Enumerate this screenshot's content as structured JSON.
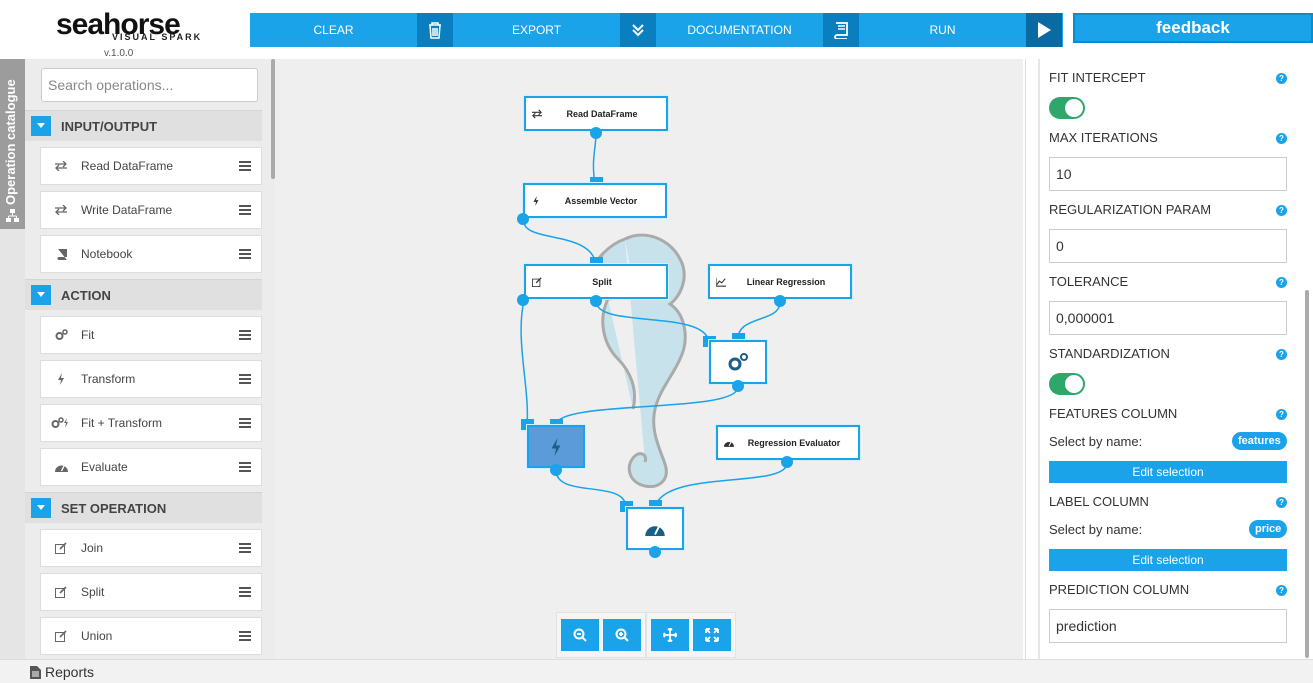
{
  "app": {
    "brand_main": "seahorse",
    "brand_sub": "VISUAL SPARK",
    "version": "v.1.0.0"
  },
  "toolbar": {
    "clear_label": "CLEAR",
    "export_label": "EXPORT",
    "documentation_label": "DOCUMENTATION",
    "run_label": "RUN"
  },
  "feedback_label": "feedback",
  "sidebar": {
    "tab_label": "Operation catalogue",
    "search_placeholder": "Search operations...",
    "categories": [
      {
        "title": "INPUT/OUTPUT",
        "items": [
          {
            "label": "Read DataFrame",
            "icon": "arrows-exchange-icon"
          },
          {
            "label": "Write DataFrame",
            "icon": "arrows-exchange-icon"
          },
          {
            "label": "Notebook",
            "icon": "book-icon"
          }
        ]
      },
      {
        "title": "ACTION",
        "items": [
          {
            "label": "Fit",
            "icon": "gears-icon"
          },
          {
            "label": "Transform",
            "icon": "bolt-icon"
          },
          {
            "label": "Fit + Transform",
            "icon": "gears-bolt-icon"
          },
          {
            "label": "Evaluate",
            "icon": "dashboard-icon"
          }
        ]
      },
      {
        "title": "SET OPERATION",
        "items": [
          {
            "label": "Join",
            "icon": "edit-icon"
          },
          {
            "label": "Split",
            "icon": "edit-icon"
          },
          {
            "label": "Union",
            "icon": "edit-icon"
          }
        ]
      }
    ]
  },
  "canvas": {
    "nodes": [
      {
        "label": "Read DataFrame",
        "icon": "arrows-exchange-icon"
      },
      {
        "label": "Assemble Vector",
        "icon": "bolt-icon"
      },
      {
        "label": "Split",
        "icon": "edit-icon"
      },
      {
        "label": "Linear Regression",
        "icon": "chart-line-icon"
      },
      {
        "label": "",
        "icon": "gears-icon"
      },
      {
        "label": "",
        "icon": "bolt-icon"
      },
      {
        "label": "Regression Evaluator",
        "icon": "dashboard-icon"
      },
      {
        "label": "",
        "icon": "dashboard-icon"
      }
    ]
  },
  "params": {
    "fit_intercept_label": "FIT INTERCEPT",
    "fit_intercept_on": true,
    "max_iterations_label": "MAX ITERATIONS",
    "max_iterations_value": "10",
    "regularization_label": "REGULARIZATION PARAM",
    "regularization_value": "0",
    "tolerance_label": "TOLERANCE",
    "tolerance_value": "0,000001",
    "standardization_label": "STANDARDIZATION",
    "standardization_on": true,
    "features_column_label": "FEATURES COLUMN",
    "features_select_text": "Select by name:",
    "features_badge": "features",
    "features_edit_label": "Edit selection",
    "label_column_label": "LABEL COLUMN",
    "label_select_text": "Select by name:",
    "label_badge": "price",
    "label_edit_label": "Edit selection",
    "prediction_column_label": "PREDICTION COLUMN",
    "prediction_column_value": "prediction",
    "help_glyph": "?"
  },
  "bottombar": {
    "reports_label": "Reports"
  },
  "colors": {
    "accent": "#1aa3e8",
    "toggle_on": "#2fa66a"
  }
}
